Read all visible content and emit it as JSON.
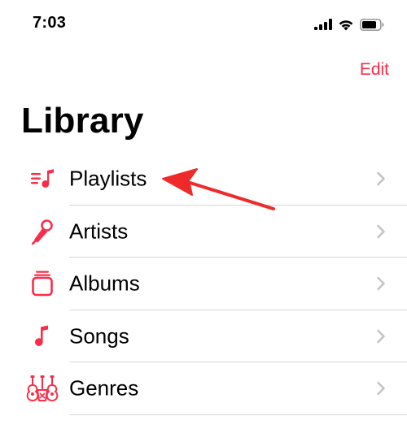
{
  "status_bar": {
    "time": "7:03",
    "icons": [
      "cellular-signal-icon",
      "wifi-icon",
      "battery-icon"
    ]
  },
  "nav": {
    "edit_label": "Edit"
  },
  "title": "Library",
  "items": [
    {
      "label": "Playlists",
      "icon": "playlist-icon"
    },
    {
      "label": "Artists",
      "icon": "microphone-icon"
    },
    {
      "label": "Albums",
      "icon": "album-stack-icon"
    },
    {
      "label": "Songs",
      "icon": "music-note-icon"
    },
    {
      "label": "Genres",
      "icon": "genres-guitar-icon"
    }
  ],
  "colors": {
    "accent": "#fa2d48",
    "chevron": "#c4c4c7",
    "divider": "#d6d6d9",
    "annotation_arrow": "#ee2a2a"
  }
}
